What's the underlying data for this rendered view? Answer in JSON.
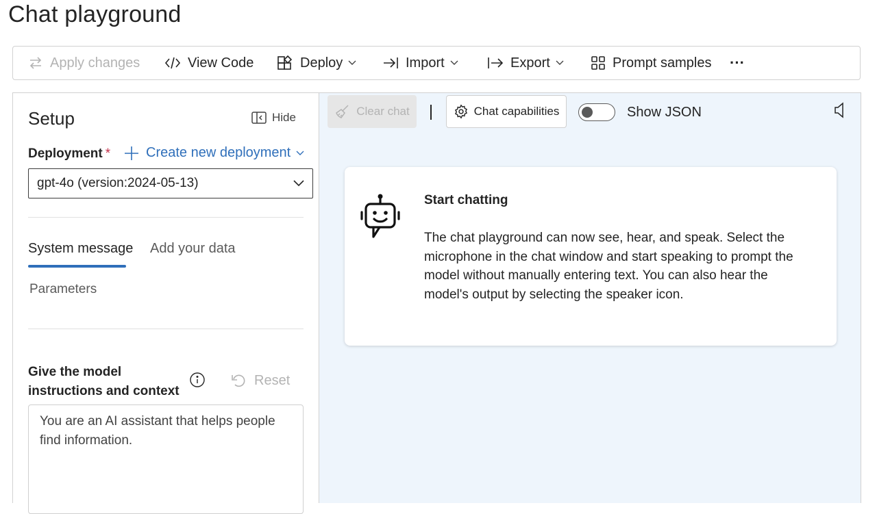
{
  "page": {
    "title": "Chat playground"
  },
  "toolbar": {
    "apply_changes": "Apply changes",
    "view_code": "View Code",
    "deploy": "Deploy",
    "import": "Import",
    "export": "Export",
    "prompt_samples": "Prompt samples",
    "more": "···"
  },
  "setup": {
    "title": "Setup",
    "hide": "Hide",
    "deployment_label": "Deployment",
    "required_mark": "*",
    "create_deployment": "Create new deployment",
    "selected_deployment": "gpt-4o (version:2024-05-13)",
    "tabs": [
      {
        "label": "System message",
        "active": true
      },
      {
        "label": "Add your data",
        "active": false
      }
    ],
    "parameters": "Parameters",
    "instructions_label": "Give the model instructions and context",
    "reset": "Reset",
    "system_message": "You are an AI assistant that helps people find information."
  },
  "chat": {
    "clear_chat": "Clear chat",
    "capabilities": "Chat capabilities",
    "show_json": "Show JSON",
    "show_json_on": false,
    "card": {
      "title": "Start chatting",
      "body": "The chat playground can now see, hear, and speak. Select the microphone in the chat window and start speaking to prompt the model without manually entering text. You can also hear the model's output by selecting the speaker icon."
    }
  },
  "colors": {
    "accent": "#2f6fba",
    "chat_bg": "#eef5fc",
    "required": "#c4314b"
  },
  "icons": [
    "swap-arrows-icon",
    "code-icon",
    "deploy-icon",
    "import-icon",
    "export-icon",
    "grid-icon",
    "more-icon",
    "hide-panel-icon",
    "plus-icon",
    "chevron-down-icon",
    "info-icon",
    "reset-icon",
    "broom-icon",
    "gear-icon",
    "speaker-icon",
    "robot-icon"
  ]
}
